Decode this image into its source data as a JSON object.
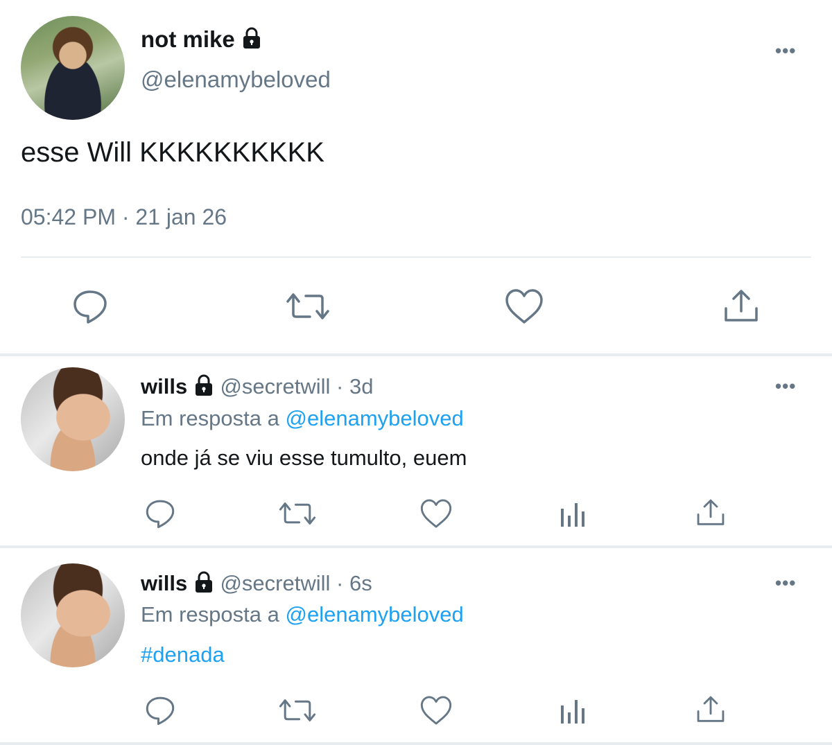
{
  "main_tweet": {
    "display_name": "not mike",
    "handle": "@elenamybeloved",
    "text": "esse Will KKKKKKKKKK",
    "timestamp": "05:42 PM · 21 jan 26",
    "more_label": "•••"
  },
  "replies": [
    {
      "display_name": "wills",
      "handle": "@secretwill",
      "time": "· 3d",
      "reply_prefix": "Em resposta a",
      "reply_to": "@elenamybeloved",
      "text": "onde já se viu esse tumulto, euem",
      "more_label": "•••"
    },
    {
      "display_name": "wills",
      "handle": "@secretwill",
      "time": "· 6s",
      "reply_prefix": "Em resposta a",
      "reply_to": "@elenamybeloved",
      "text": "#denada",
      "more_label": "•••"
    }
  ],
  "colors": {
    "text": "#14171a",
    "muted": "#657786",
    "link": "#1da1f2",
    "divider": "#e6ecf0"
  },
  "icons": [
    "lock-icon",
    "more-icon",
    "reply-icon",
    "retweet-icon",
    "like-icon",
    "analytics-icon",
    "share-icon"
  ]
}
